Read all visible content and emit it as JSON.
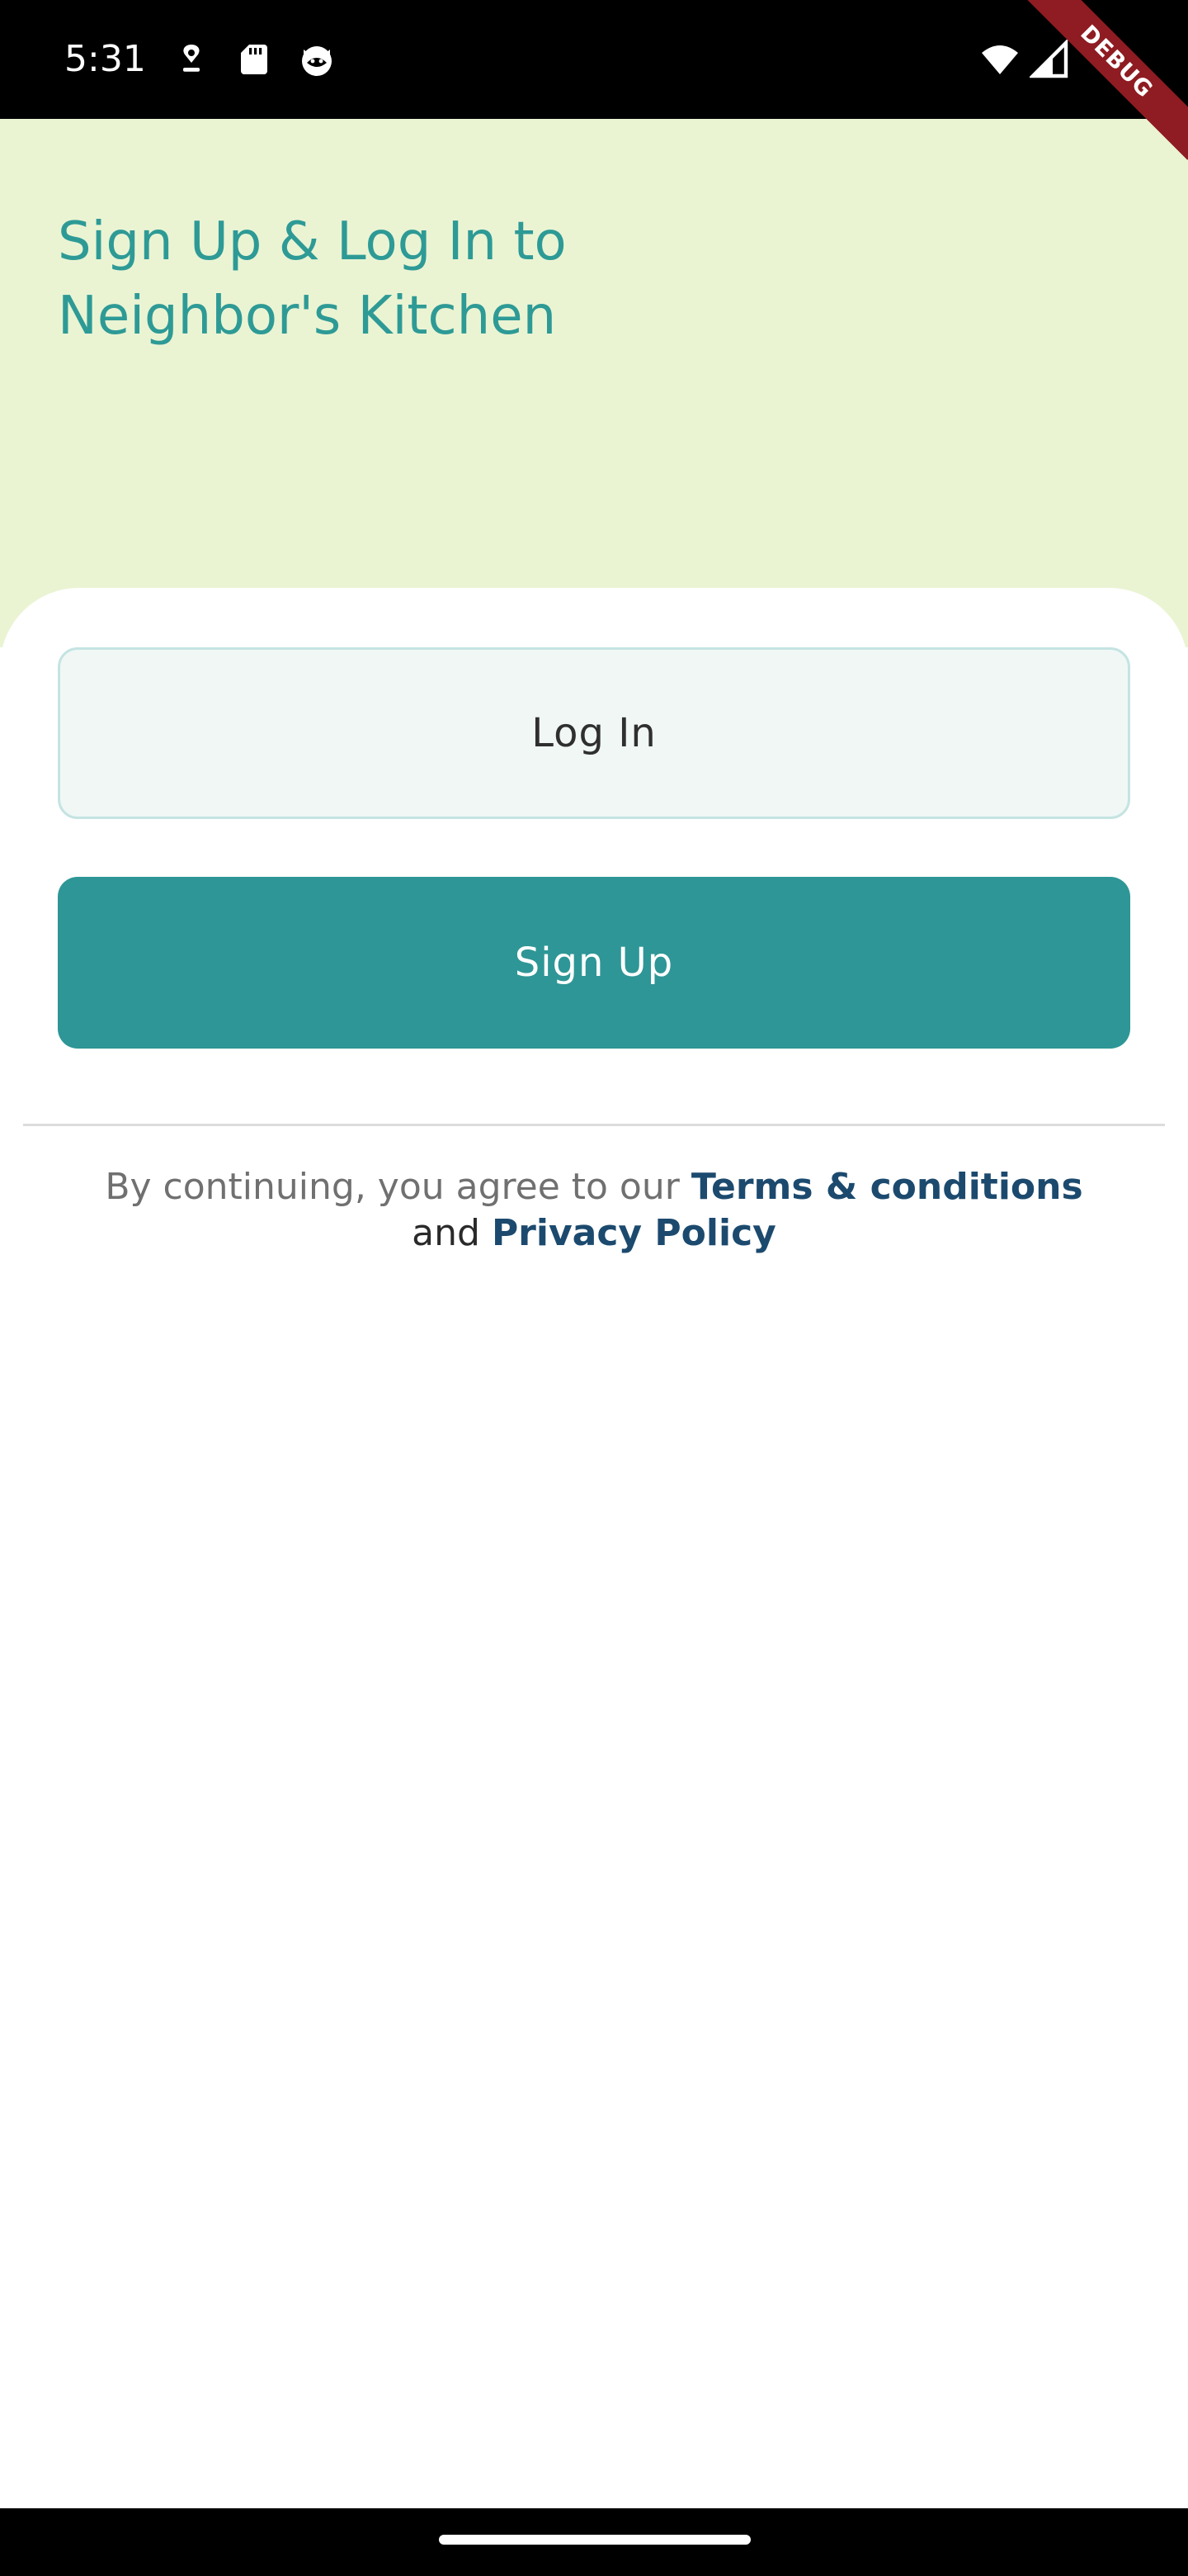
{
  "status_bar": {
    "time": "5:31",
    "icons": [
      "download-icon",
      "sd-card-icon",
      "cat-face-icon",
      "wifi-icon",
      "cellular-signal-icon"
    ]
  },
  "debug_banner": "DEBUG",
  "header": {
    "title": "Sign Up & Log In to\nNeighbor's Kitchen"
  },
  "actions": {
    "login_label": "Log In",
    "signup_label": "Sign Up"
  },
  "terms": {
    "prefix": "By continuing, you agree to our ",
    "terms_link": "Terms & conditions",
    "and_text": "and",
    "privacy_link": "Privacy Policy"
  },
  "colors": {
    "hero_background": "#eaf4d3",
    "accent_teal": "#2e9696",
    "title_teal": "#2e9a96",
    "link_navy": "#1c4a6e",
    "login_button_background": "#f0f7f5",
    "debug_ribbon": "#8e1c22"
  }
}
